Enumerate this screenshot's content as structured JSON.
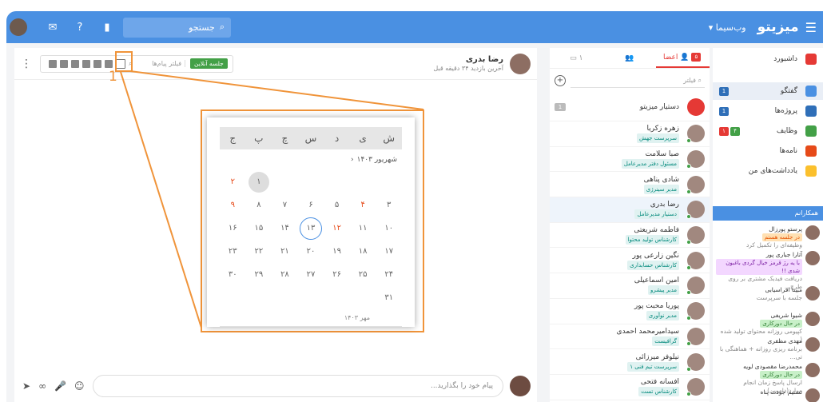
{
  "header": {
    "brand": "میزیتو",
    "brand_sub": "وب‌سیما ▾",
    "search_placeholder": "جستجو",
    "icons": [
      "menu-icon",
      "search-icon",
      "chat-icon",
      "help-icon",
      "bookmark-icon"
    ]
  },
  "sidebar": {
    "items": [
      {
        "label": "داشبورد",
        "badges": [],
        "color": "#e53935"
      },
      {
        "label": "گفتگو",
        "badges": [
          "1"
        ],
        "color": "#4a90e2"
      },
      {
        "label": "پروژه‌ها",
        "badges": [
          "1"
        ],
        "color": "#2f6fb8"
      },
      {
        "label": "وظایف",
        "badges": [
          "۴",
          "۱"
        ],
        "color": "#43a047"
      },
      {
        "label": "نامه‌ها",
        "badges": [],
        "color": "#e64a19"
      },
      {
        "label": "یادداشت‌های من",
        "badges": [],
        "color": "#fbc02d"
      }
    ],
    "team_title": "همکارانم",
    "team": [
      {
        "name": "پرستو پورزال",
        "status": "در جلسه هستم",
        "note": "وظیفه‌ای را تکمیل کرد"
      },
      {
        "name": "آتارا جباری پور",
        "status": "با یه رژ قرمز خیال گردی باغبون شدی !!",
        "note": "دریافت فیدبک مشتری بر روی طرح..."
      },
      {
        "name": "مبینا افراسیابی",
        "status": "",
        "note": "جلسه با سرپرست"
      },
      {
        "name": "شیوا شریفی",
        "status": "در حال دورکاری",
        "note": "کپیومی روزانه محتوای تولید شده (..."
      },
      {
        "name": "مهدی مظفری",
        "status": "",
        "note": "برنامه ریزی روزانه + هماهنگی با تی..."
      },
      {
        "name": "محمدرضا مقصودی لویه",
        "status": "در حال دورکاری",
        "note": "ارسال پاسخ زمان انجام موارد(داموین)"
      },
      {
        "name": "تسنیم جودت پناه",
        "status": "",
        "note": ""
      }
    ]
  },
  "contacts": {
    "tabs": [
      {
        "label": "اعضا",
        "badge": "۵"
      },
      {
        "label": "گروه‌ها",
        "badge": ""
      },
      {
        "label": "۱",
        "badge": ""
      }
    ],
    "filter_placeholder": "فیلتر",
    "rows": [
      {
        "name": "دستیار میزیتو",
        "role": "",
        "count": "1"
      },
      {
        "name": "زهره زکریا",
        "role": "سرپرست جهش",
        "count": ""
      },
      {
        "name": "صبا سلامت",
        "role": "مسئول دفتر مدیرعامل",
        "count": ""
      },
      {
        "name": "شادی پناهی",
        "role": "مدیر سینرژی",
        "count": ""
      },
      {
        "name": "رضا بدری",
        "role": "دستیار مدیرعامل",
        "count": ""
      },
      {
        "name": "فاطمه شریعتی",
        "role": "کارشناس تولید محتوا",
        "count": ""
      },
      {
        "name": "نگین زارعی پور",
        "role": "کارشناس حسابداری",
        "count": ""
      },
      {
        "name": "امین اسماعیلی",
        "role": "مدیر پیشرو",
        "count": ""
      },
      {
        "name": "پوریا محبت پور",
        "role": "مدیر نوآوری",
        "count": ""
      },
      {
        "name": "سیدامیرمحمد احمدی",
        "role": "گرافیست",
        "count": ""
      },
      {
        "name": "نیلوفر میرزائی",
        "role": "سرپرست تیم فنی ۱",
        "count": ""
      },
      {
        "name": "افسانه فتحی",
        "role": "کارشناس تست",
        "count": ""
      }
    ]
  },
  "chat": {
    "user_name": "رضا بدری",
    "last_seen": "آخرین بازدید ۳۴ دقیقه قبل",
    "live_btn": "جلسه آنلاین",
    "msg_filter": "فیلتر پیام‌ها",
    "composer_placeholder": "پیام خود را بگذارید..."
  },
  "callouts": {
    "num1": "1",
    "num2": "2"
  },
  "calendar": {
    "weekdays": [
      "ش",
      "ی",
      "د",
      "س",
      "چ",
      "پ",
      "ج"
    ],
    "month": "شهریور ۱۴۰۳",
    "cells": [
      "",
      "",
      "",
      "",
      "",
      "۱",
      "۲",
      "۳",
      "۴",
      "۵",
      "۶",
      "۷",
      "۸",
      "۹",
      "۱۰",
      "۱۱",
      "۱۲",
      "۱۳",
      "۱۴",
      "۱۵",
      "۱۶",
      "۱۷",
      "۱۸",
      "۱۹",
      "۲۰",
      "۲۱",
      "۲۲",
      "۲۳",
      "۲۴",
      "۲۵",
      "۲۶",
      "۲۷",
      "۲۸",
      "۲۹",
      "۳۰",
      "۳۱",
      "",
      "",
      "",
      "",
      "",
      ""
    ],
    "selected": "۱",
    "today": "۱۳",
    "friday_red": [
      "۲",
      "۹"
    ],
    "red_extra": [
      "۴",
      "۱۲"
    ],
    "next_month": "مهر ۱۴۰۳"
  }
}
